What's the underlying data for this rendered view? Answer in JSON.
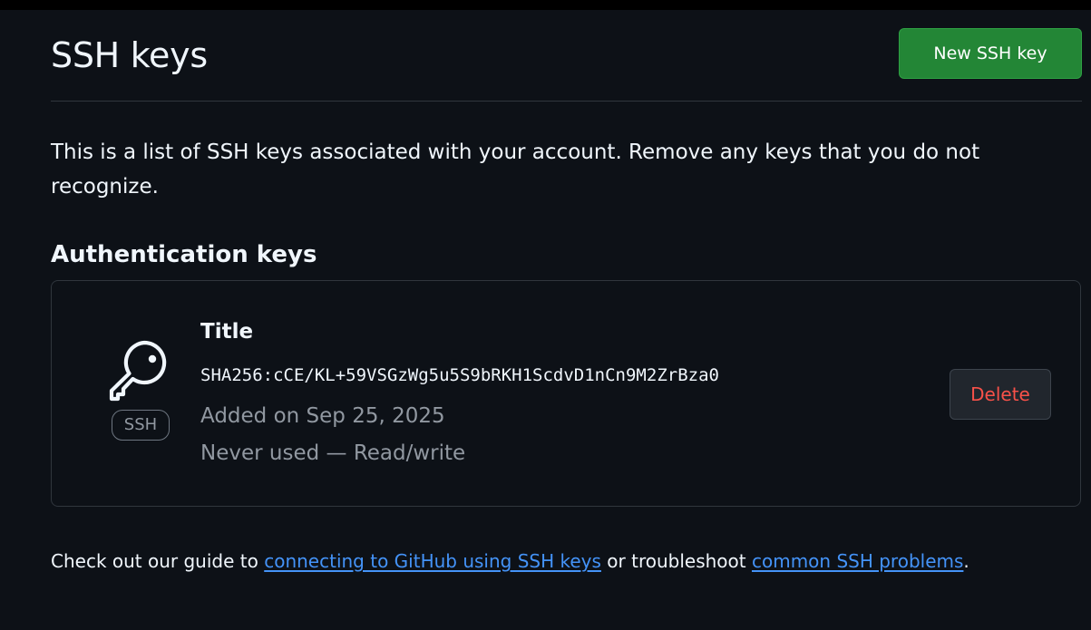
{
  "header": {
    "title": "SSH keys",
    "new_key_label": "New SSH key"
  },
  "intro_text": "This is a list of SSH keys associated with your account. Remove any keys that you do not recognize.",
  "section": {
    "title": "Authentication keys"
  },
  "key": {
    "icon": "key-icon",
    "badge": "SSH",
    "title": "Title",
    "fingerprint": "SHA256:cCE/KL+59VSGzWg5u5S9bRKH1ScdvD1nCn9M2ZrBza0",
    "added_on": "Added on Sep 25, 2025",
    "usage": "Never used — Read/write",
    "delete_label": "Delete"
  },
  "guide": {
    "prefix": "Check out our guide to ",
    "link1": "connecting to GitHub using SSH keys",
    "middle": " or troubleshoot ",
    "link2": "common SSH problems",
    "suffix": "."
  },
  "colors": {
    "background": "#0d1117",
    "primary_button": "#238636",
    "danger_text": "#f85149",
    "link": "#4493f8",
    "muted_text": "#9198a1",
    "border": "#30363d"
  }
}
